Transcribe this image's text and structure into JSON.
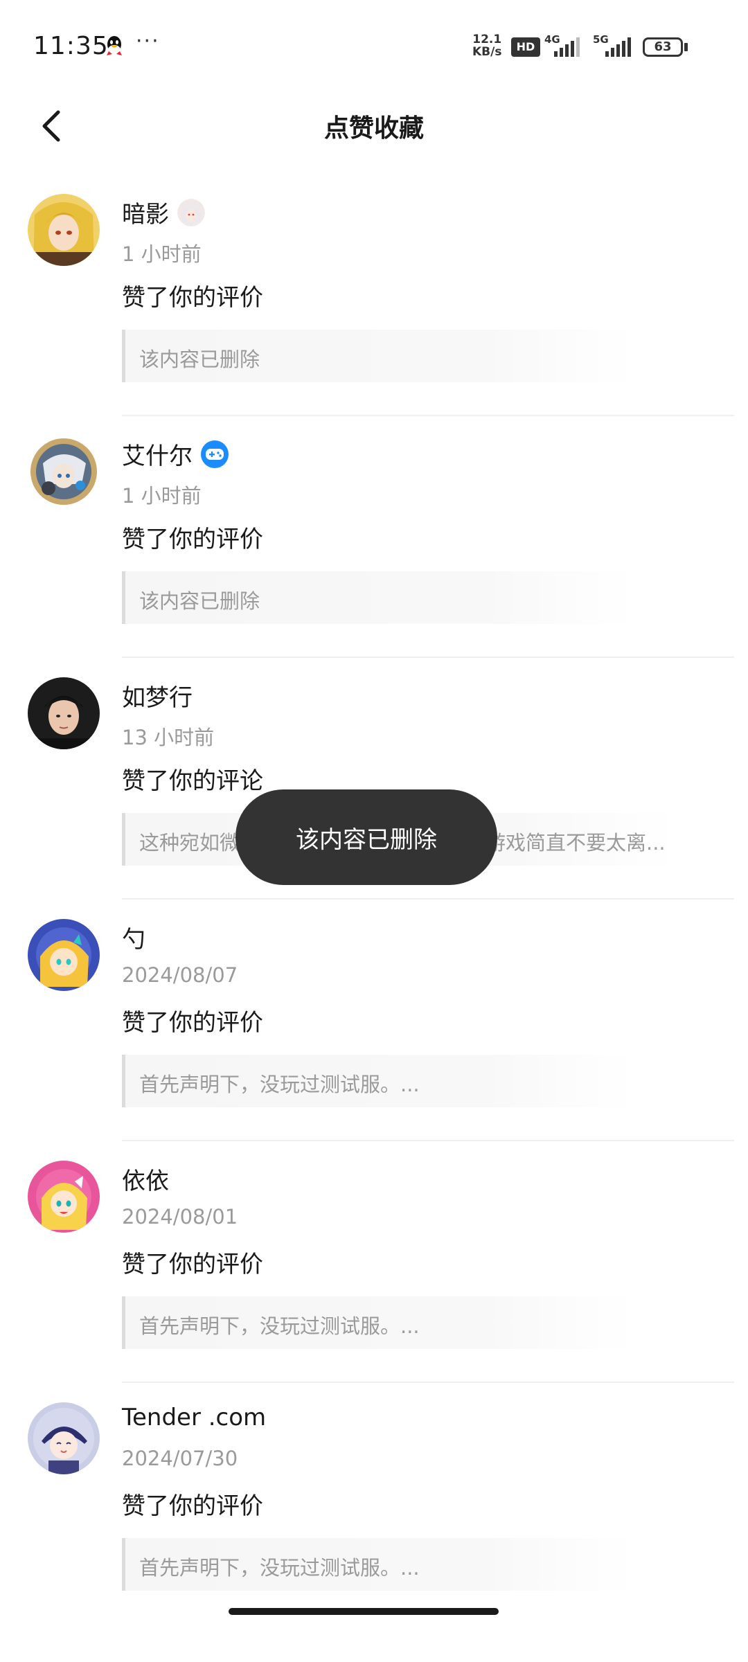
{
  "status_bar": {
    "time": "11:35",
    "more": "···",
    "net_speed_value": "12.1",
    "net_speed_unit": "KB/s",
    "hd_label": "HD",
    "signal1_label": "4G",
    "signal2_label": "5G",
    "battery": "63"
  },
  "header": {
    "title": "点赞收藏"
  },
  "items": [
    {
      "name": "暗影",
      "time": "1 小时前",
      "action": "赞了你的评价",
      "quote": "该内容已删除"
    },
    {
      "name": "艾什尔",
      "time": "1 小时前",
      "action": "赞了你的评价",
      "quote": "该内容已删除"
    },
    {
      "name": "如梦行",
      "time": "13 小时前",
      "action": "赞了你的评论",
      "quote": "这种宛如微",
      "quote_tail": "游戏简直不要太离..."
    },
    {
      "name": "勺",
      "time": "2024/08/07",
      "action": "赞了你的评价",
      "quote": "首先声明下，没玩过测试服。..."
    },
    {
      "name": "依依",
      "time": "2024/08/01",
      "action": "赞了你的评价",
      "quote": "首先声明下，没玩过测试服。..."
    },
    {
      "name": "Tender .com",
      "time": "2024/07/30",
      "action": "赞了你的评价",
      "quote": "首先声明下，没玩过测试服。..."
    }
  ],
  "toast": {
    "text": "该内容已删除"
  },
  "colors": {
    "toast_bg": "#333333",
    "muted_text": "#9a9a9a",
    "game_badge": "#1a8cff"
  }
}
